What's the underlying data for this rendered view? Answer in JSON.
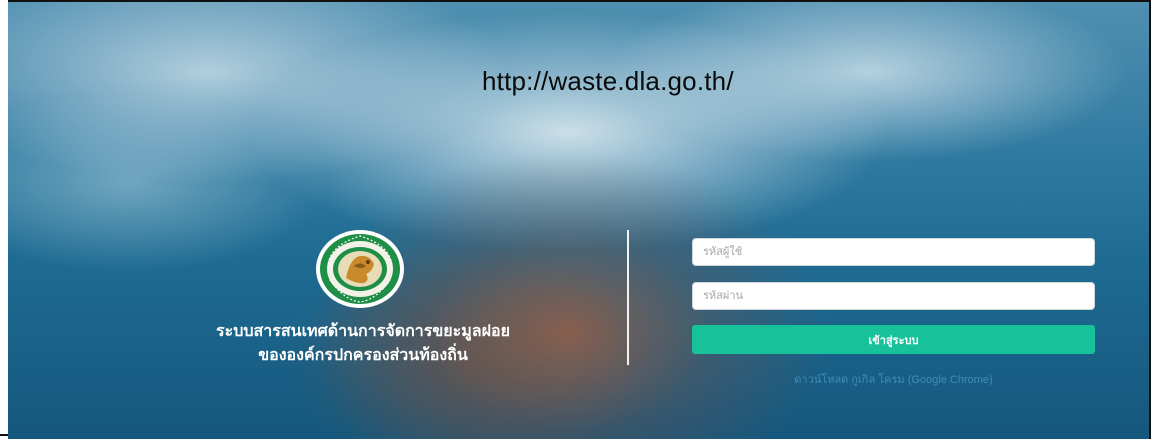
{
  "header": {
    "url_text": "http://waste.dla.go.th/"
  },
  "branding": {
    "logo_icon": "dla-seal-emblem-icon",
    "title_line1": "ระบบสารสนเทศด้านการจัดการขยะมูลฝอย",
    "title_line2": "ขององค์กรปกครองส่วนท้องถิ่น"
  },
  "login": {
    "username_placeholder": "รหัสผู้ใช้",
    "username_value": "",
    "password_placeholder": "รหัสผ่าน",
    "password_value": "",
    "submit_label": "เข้าสู่ระบบ",
    "download_link": "ดาวน์โหลด กูเกิล โครม (Google Chrome)"
  },
  "colors": {
    "accent": "#17c29a",
    "link": "#3f8db8",
    "background_ocean": "#1e6b92"
  }
}
